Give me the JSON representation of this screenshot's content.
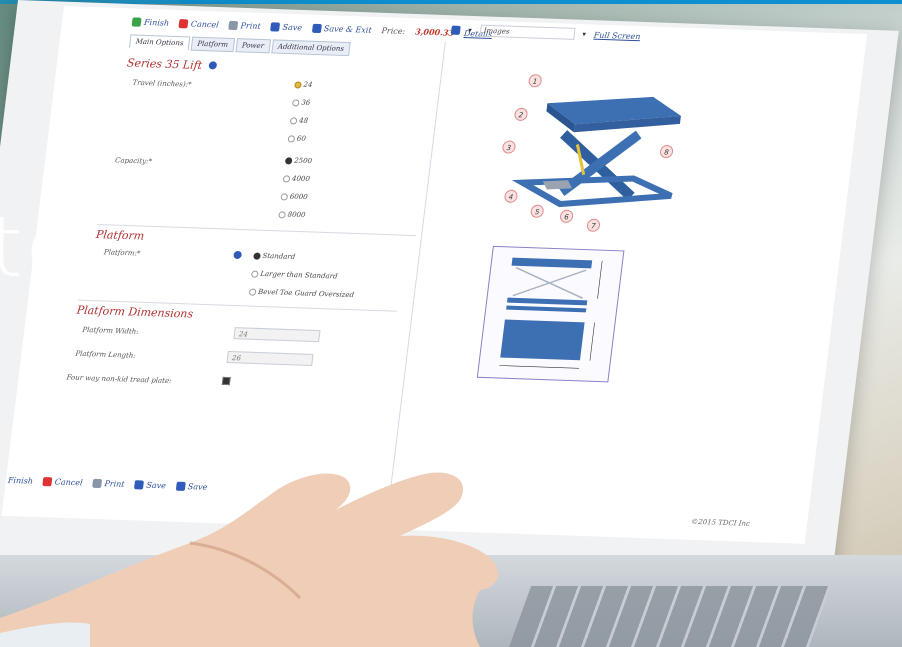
{
  "backdrop": {
    "partial_word": "te"
  },
  "toolbar": {
    "finish": "Finish",
    "cancel": "Cancel",
    "print": "Print",
    "save": "Save",
    "save_exit": "Save & Exit",
    "price_label": "Price:",
    "price_value": "3,000.33",
    "details": "Details"
  },
  "tabs": [
    "Main Options",
    "Platform",
    "Power",
    "Additional Options"
  ],
  "series": {
    "title": "Series 35 Lift",
    "travel_label": "Travel (inches):*",
    "travel_options": [
      "24",
      "36",
      "48",
      "60"
    ],
    "capacity_label": "Capacity:*",
    "capacity_options": [
      "2500",
      "4000",
      "6000",
      "8000"
    ]
  },
  "platform": {
    "title": "Platform",
    "label": "Platform:*",
    "options": [
      "Standard",
      "Larger than Standard",
      "Bevel Toe Guard Oversized"
    ]
  },
  "dimensions": {
    "title": "Platform Dimensions",
    "width_label": "Platform Width:",
    "width_value": "24",
    "length_label": "Platform Length:",
    "length_value": "26",
    "tread_label": "Four way non-kid tread plate:"
  },
  "viewer": {
    "view_select": "Images",
    "full_screen": "Full Screen"
  },
  "callouts": [
    "1",
    "2",
    "3",
    "4",
    "5",
    "6",
    "7",
    "8"
  ],
  "bottom_toolbar": {
    "finish": "Finish",
    "cancel": "Cancel",
    "print": "Print",
    "save": "Save",
    "save_partial": "Save"
  },
  "footer": {
    "copyright": "©2015 TDCI Inc"
  },
  "colors": {
    "accent_bar": "#0e8fcf",
    "section_title": "#b03030",
    "lift_blue": "#3d6fb3",
    "price_red": "#c0392b"
  }
}
